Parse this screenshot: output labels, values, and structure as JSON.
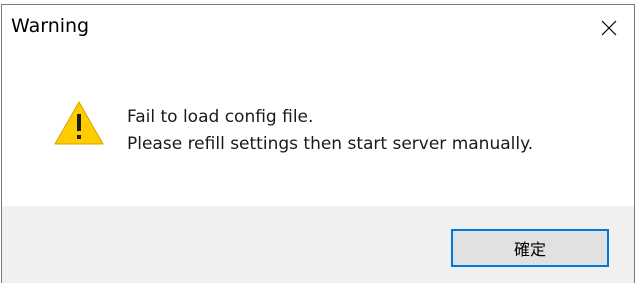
{
  "dialog": {
    "title": "Warning",
    "close_icon": "close-icon",
    "warning_icon": "warning-triangle-icon",
    "message_line1": "Fail to load config file.",
    "message_line2": "Please refill settings then start server manually.",
    "ok_label": "確定"
  },
  "colors": {
    "focus_border": "#0078d7",
    "button_face": "#e1e1e1",
    "footer_bg": "#f0f0f0",
    "warning_yellow": "#ffcc00"
  }
}
